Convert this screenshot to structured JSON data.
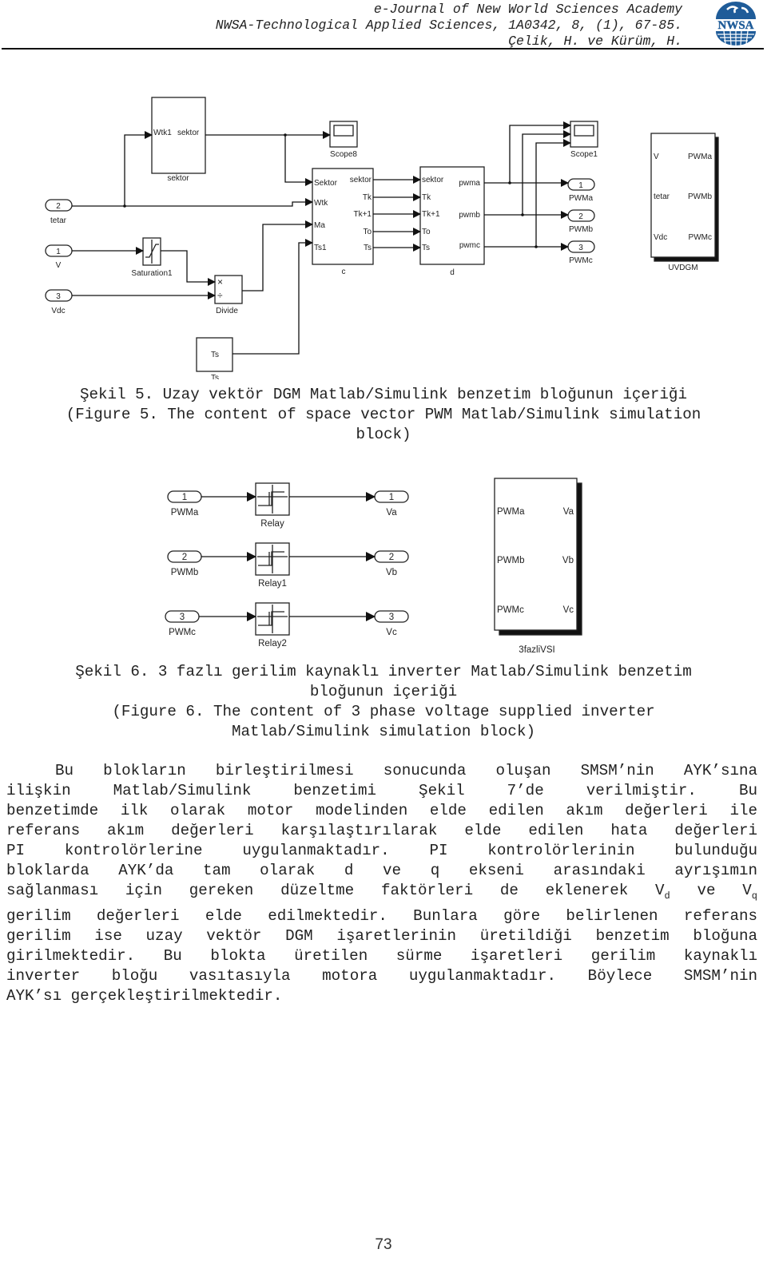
{
  "header": {
    "line1": "e-Journal of New World Sciences Academy",
    "line2": "NWSA-Technological Applied Sciences, 1A0342, 8, (1), 67-85.",
    "line3": "Çelik, H. ve Kürüm, H.",
    "logo_text": "NWSA",
    "logo_icon": "globe-logo-icon",
    "brand_color": "#1f5c99"
  },
  "figure5": {
    "blocks": {
      "sektor": {
        "in": "Wtk1",
        "out": "sektor",
        "name": "sektor"
      },
      "scope8": "Scope8",
      "scope1": "Scope1",
      "c": {
        "name": "c",
        "inputs": [
          "Sektor",
          "Wtk",
          "Ma",
          "Ts1"
        ],
        "outputs": [
          "sektor",
          "Tk",
          "Tk+1",
          "To",
          "Ts"
        ]
      },
      "d": {
        "name": "d",
        "inputs": [
          "sektor",
          "Tk",
          "Tk+1",
          "To",
          "Ts"
        ],
        "outputs": [
          "pwma",
          "pwmb",
          "pwmc"
        ]
      },
      "saturation": "Saturation1",
      "divide": {
        "name": "Divide",
        "op1": "×",
        "op2": "÷"
      },
      "ts_const": {
        "value": "Ts",
        "name": "Ts"
      },
      "uvdgm": {
        "name": "UVDGM",
        "inputs": [
          "V",
          "tetar",
          "Vdc"
        ],
        "outputs": [
          "PWMa",
          "PWMb",
          "PWMc"
        ]
      }
    },
    "inports": [
      {
        "num": "2",
        "label": "tetar"
      },
      {
        "num": "1",
        "label": "V"
      },
      {
        "num": "3",
        "label": "Vdc"
      }
    ],
    "outports": [
      {
        "num": "1",
        "label": "PWMa"
      },
      {
        "num": "2",
        "label": "PWMb"
      },
      {
        "num": "3",
        "label": "PWMc"
      }
    ],
    "caption_tr": "Şekil 5. Uzay vektör DGM Matlab/Simulink benzetim bloğunun içeriği",
    "caption_en_1": "(Figure 5. The content of space vector PWM Matlab/Simulink simulation",
    "caption_en_2": "block)"
  },
  "figure6": {
    "inports": [
      {
        "num": "1",
        "label": "PWMa"
      },
      {
        "num": "2",
        "label": "PWMb"
      },
      {
        "num": "3",
        "label": "PWMc"
      }
    ],
    "relays": [
      "Relay",
      "Relay1",
      "Relay2"
    ],
    "outports": [
      {
        "num": "1",
        "label": "Va"
      },
      {
        "num": "2",
        "label": "Vb"
      },
      {
        "num": "3",
        "label": "Vc"
      }
    ],
    "vsi": {
      "name": "3fazliVSI",
      "inputs": [
        "PWMa",
        "PWMb",
        "PWMc"
      ],
      "outputs": [
        "Va",
        "Vb",
        "Vc"
      ]
    },
    "caption_tr_1": "Şekil 6. 3 fazlı gerilim kaynaklı inverter Matlab/Simulink benzetim",
    "caption_tr_2": "bloğunun içeriği",
    "caption_en_1": "(Figure 6. The content of 3 phase voltage supplied inverter",
    "caption_en_2": "Matlab/Simulink simulation block)"
  },
  "paragraph": {
    "lines": [
      "Bu blokların birleştirilmesi sonucunda oluşan SMSM’nin AYK’sına",
      "ilişkin Matlab/Simulink benzetimi Şekil 7’de verilmiştir. Bu",
      "benzetimde ilk olarak motor modelinden elde edilen akım değerleri ile",
      "referans akım değerleri karşılaştırılarak elde edilen hata değerleri",
      "PI kontrolörlerine uygulanmaktadır. PI kontrolörlerinin bulunduğu",
      "bloklarda AYK’da tam olarak d ve q ekseni arasındaki ayrışımın",
      "sağlanması için gereken düzeltme faktörleri de eklenerek V",
      "gerilim değerleri elde edilmektedir. Bunlara göre belirlenen referans",
      "gerilim ise uzay vektör DGM işaretlerinin üretildiği benzetim bloğuna",
      "girilmektedir. Bu blokta üretilen sürme işaretleri gerilim kaynaklı",
      "inverter bloğu vasıtasıyla motora uygulanmaktadır. Böylece SMSM’nin",
      "AYK’sı gerçekleştirilmektedir."
    ],
    "sub_d": "d",
    "ve": " ve V",
    "sub_q": "q"
  },
  "page_number": "73"
}
